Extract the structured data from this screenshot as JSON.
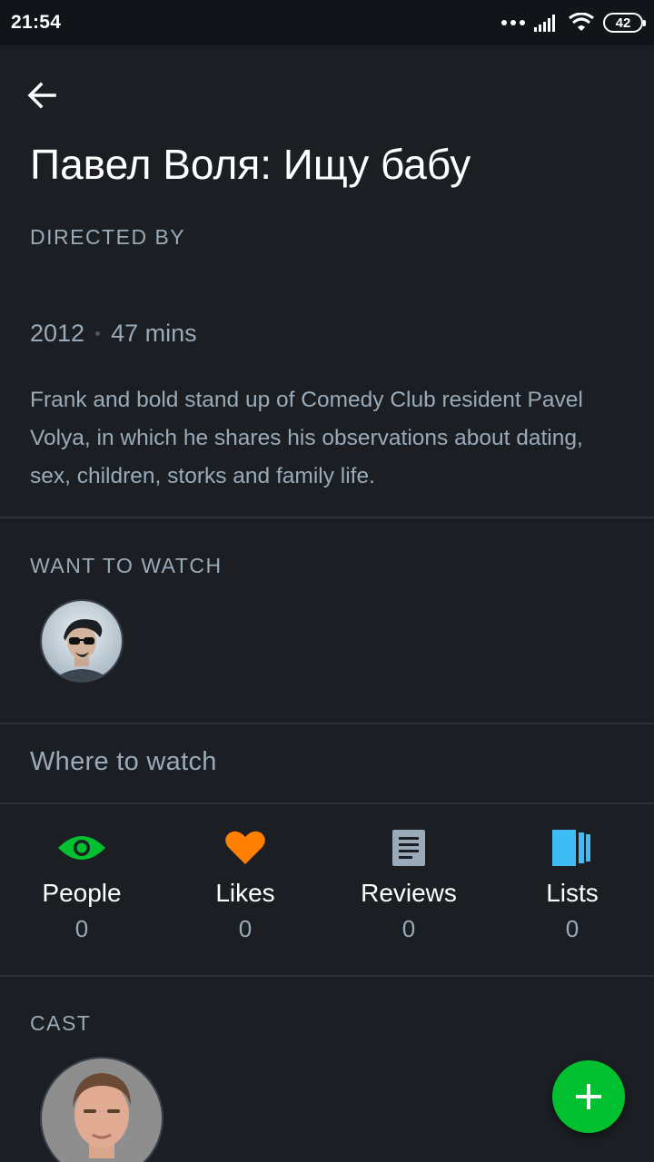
{
  "status_bar": {
    "time": "21:54",
    "battery": "42"
  },
  "film": {
    "title": "Павел Воля: Ищу бабу",
    "directed_by_label": "DIRECTED BY",
    "year": "2012",
    "runtime": "47 mins",
    "synopsis": "Frank and bold stand up of Comedy Club resident Pavel Volya, in which he shares his observations about dating, sex, children, storks and family life."
  },
  "want_to_watch": {
    "label": "WANT TO WATCH"
  },
  "where_to_watch": {
    "label": "Where to watch"
  },
  "stats": [
    {
      "label": "People",
      "count": "0",
      "icon": "eye-icon",
      "color": "#00c030"
    },
    {
      "label": "Likes",
      "count": "0",
      "icon": "heart-icon",
      "color": "#ff8000"
    },
    {
      "label": "Reviews",
      "count": "0",
      "icon": "document-icon",
      "color": "#9aaab8"
    },
    {
      "label": "Lists",
      "count": "0",
      "icon": "lists-icon",
      "color": "#40bcf4"
    }
  ],
  "cast": {
    "label": "CAST"
  },
  "colors": {
    "background": "#1b1f24",
    "muted_text": "#9aaab8",
    "accent_green": "#00c030",
    "accent_orange": "#ff8000",
    "accent_blue": "#40bcf4"
  }
}
